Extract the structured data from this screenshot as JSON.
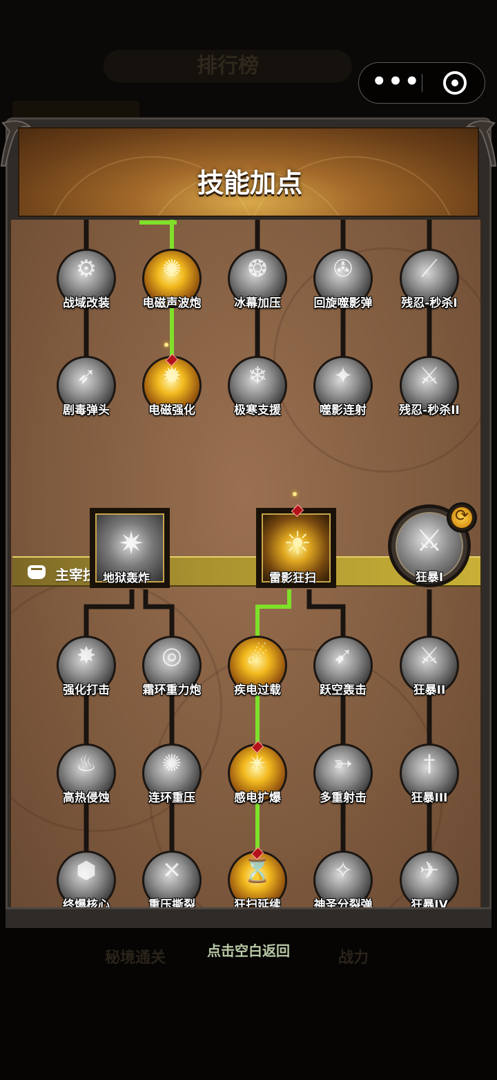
{
  "background": {
    "title": "排行榜",
    "bottom_left": "秘境通关",
    "bottom_right": "战力"
  },
  "capsule": {
    "more": "•••"
  },
  "modal": {
    "title": "技能加点",
    "section_label": "主宰技能",
    "return_hint": "点击空白返回"
  },
  "skills_top": [
    {
      "label": "战域改装",
      "icon": "tank-icon",
      "state": "locked"
    },
    {
      "label": "电磁声波炮",
      "icon": "sonic-cannon-icon",
      "state": "learned"
    },
    {
      "label": "冰幕加压",
      "icon": "ice-vortex-icon",
      "state": "locked"
    },
    {
      "label": "回旋噬影弹",
      "icon": "spiral-shadow-icon",
      "state": "locked"
    },
    {
      "label": "残忍-秒杀I",
      "icon": "slash-icon",
      "state": "locked"
    },
    {
      "label": "剧毒弹头",
      "icon": "poison-warhead-icon",
      "state": "locked"
    },
    {
      "label": "电磁强化",
      "icon": "electro-boost-icon",
      "state": "learned"
    },
    {
      "label": "极寒支援",
      "icon": "frost-support-icon",
      "state": "locked"
    },
    {
      "label": "噬影连射",
      "icon": "shadow-burst-icon",
      "state": "locked"
    },
    {
      "label": "残忍-秒杀II",
      "icon": "crystal-blade-icon",
      "state": "locked"
    }
  ],
  "ultimates": [
    {
      "label": "地狱轰炸",
      "icon": "explosion-icon",
      "state": "locked"
    },
    {
      "label": "雷影狂扫",
      "icon": "sun-blade-icon",
      "state": "learned"
    },
    {
      "label": "狂暴I",
      "icon": "berserk-icon",
      "state": "locked"
    }
  ],
  "skills_bottom": [
    {
      "label": "强化打击",
      "icon": "strike-icon",
      "state": "locked"
    },
    {
      "label": "霜环重力炮",
      "icon": "frost-ring-icon",
      "state": "locked"
    },
    {
      "label": "疾电过载",
      "icon": "overload-icon",
      "state": "learned"
    },
    {
      "label": "跃空轰击",
      "icon": "air-strike-icon",
      "state": "locked"
    },
    {
      "label": "狂暴II",
      "icon": "sword-icon",
      "state": "locked"
    },
    {
      "label": "高热侵蚀",
      "icon": "flame-icon",
      "state": "locked"
    },
    {
      "label": "连环重压",
      "icon": "chain-pressure-icon",
      "state": "locked"
    },
    {
      "label": "感电扩爆",
      "icon": "electric-blast-icon",
      "state": "learned"
    },
    {
      "label": "多重射击",
      "icon": "multi-shot-icon",
      "state": "locked"
    },
    {
      "label": "狂暴III",
      "icon": "dagger-icon",
      "state": "locked"
    },
    {
      "label": "终爆核心",
      "icon": "core-blast-icon",
      "state": "locked"
    },
    {
      "label": "重压撕裂",
      "icon": "rend-icon",
      "state": "locked"
    },
    {
      "label": "狂扫延续",
      "icon": "hourglass-icon",
      "state": "learned"
    },
    {
      "label": "神圣分裂弹",
      "icon": "holy-split-icon",
      "state": "locked"
    },
    {
      "label": "狂暴IV",
      "icon": "rage-icon",
      "state": "locked"
    }
  ],
  "colors": {
    "learned_path": "#7fe02a",
    "locked_path": "#1a1410",
    "section_bar": "#c9b037",
    "header_glow": "#d9a94a"
  }
}
